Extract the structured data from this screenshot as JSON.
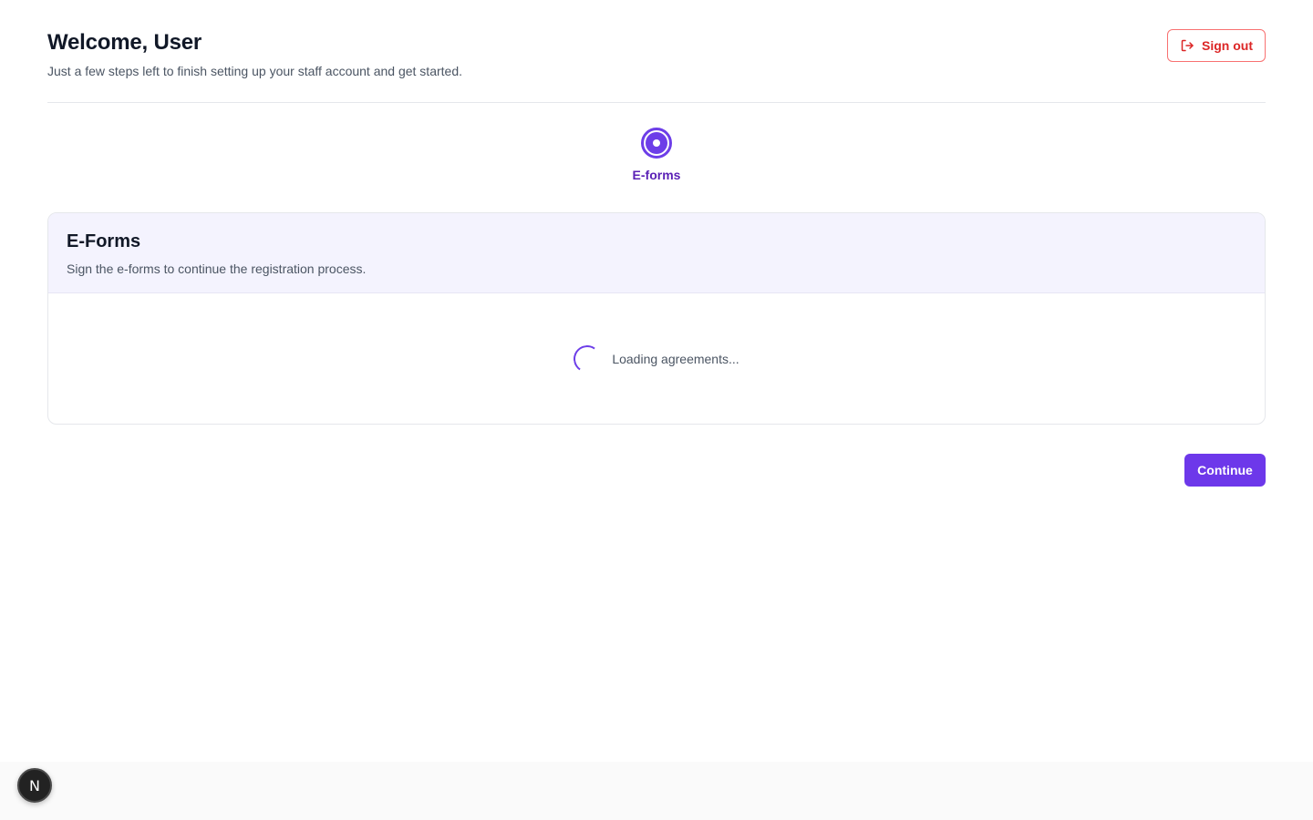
{
  "header": {
    "title": "Welcome, User",
    "subtitle": "Just a few steps left to finish setting up your staff account and get started.",
    "signout_label": "Sign out",
    "signout_icon": "logout-icon"
  },
  "stepper": {
    "steps": [
      {
        "label": "E-forms",
        "state": "current"
      }
    ]
  },
  "card": {
    "title": "E-Forms",
    "description": "Sign the e-forms to continue the registration process.",
    "loading_text": "Loading agreements..."
  },
  "actions": {
    "continue_label": "Continue"
  },
  "dev_badge": {
    "letter": "N"
  },
  "colors": {
    "accent": "#6d38ea",
    "danger": "#dc2626",
    "card_header_bg": "#f4f3fe"
  }
}
